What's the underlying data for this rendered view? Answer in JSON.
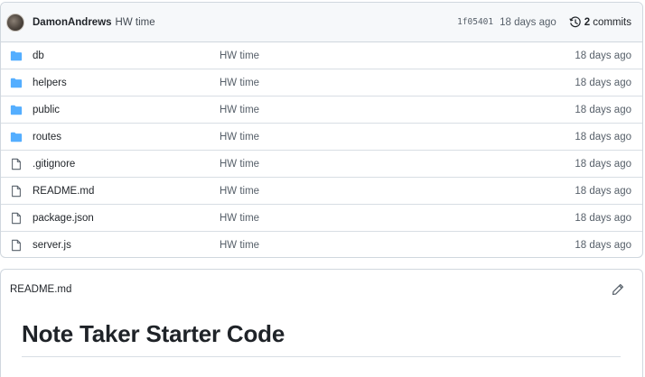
{
  "latest_commit": {
    "author": "DamonAndrews",
    "message": "HW time",
    "sha": "1f05401",
    "age": "18 days ago",
    "commits_count": "2",
    "commits_label": "commits",
    "icons": {
      "avatar": "user-avatar",
      "history": "history-icon"
    }
  },
  "files": [
    {
      "name": "db",
      "type": "folder",
      "message": "HW time",
      "age": "18 days ago"
    },
    {
      "name": "helpers",
      "type": "folder",
      "message": "HW time",
      "age": "18 days ago"
    },
    {
      "name": "public",
      "type": "folder",
      "message": "HW time",
      "age": "18 days ago"
    },
    {
      "name": "routes",
      "type": "folder",
      "message": "HW time",
      "age": "18 days ago"
    },
    {
      "name": ".gitignore",
      "type": "file",
      "message": "HW time",
      "age": "18 days ago"
    },
    {
      "name": "README.md",
      "type": "file",
      "message": "HW time",
      "age": "18 days ago"
    },
    {
      "name": "package.json",
      "type": "file",
      "message": "HW time",
      "age": "18 days ago"
    },
    {
      "name": "server.js",
      "type": "file",
      "message": "HW time",
      "age": "18 days ago"
    }
  ],
  "readme": {
    "filename": "README.md",
    "heading": "Note Taker Starter Code",
    "icons": {
      "edit": "pencil-icon"
    }
  },
  "colors": {
    "folder": "#54aeff",
    "file": "#57606a",
    "border": "#d0d7de",
    "header_bg": "#f6f8fa"
  }
}
